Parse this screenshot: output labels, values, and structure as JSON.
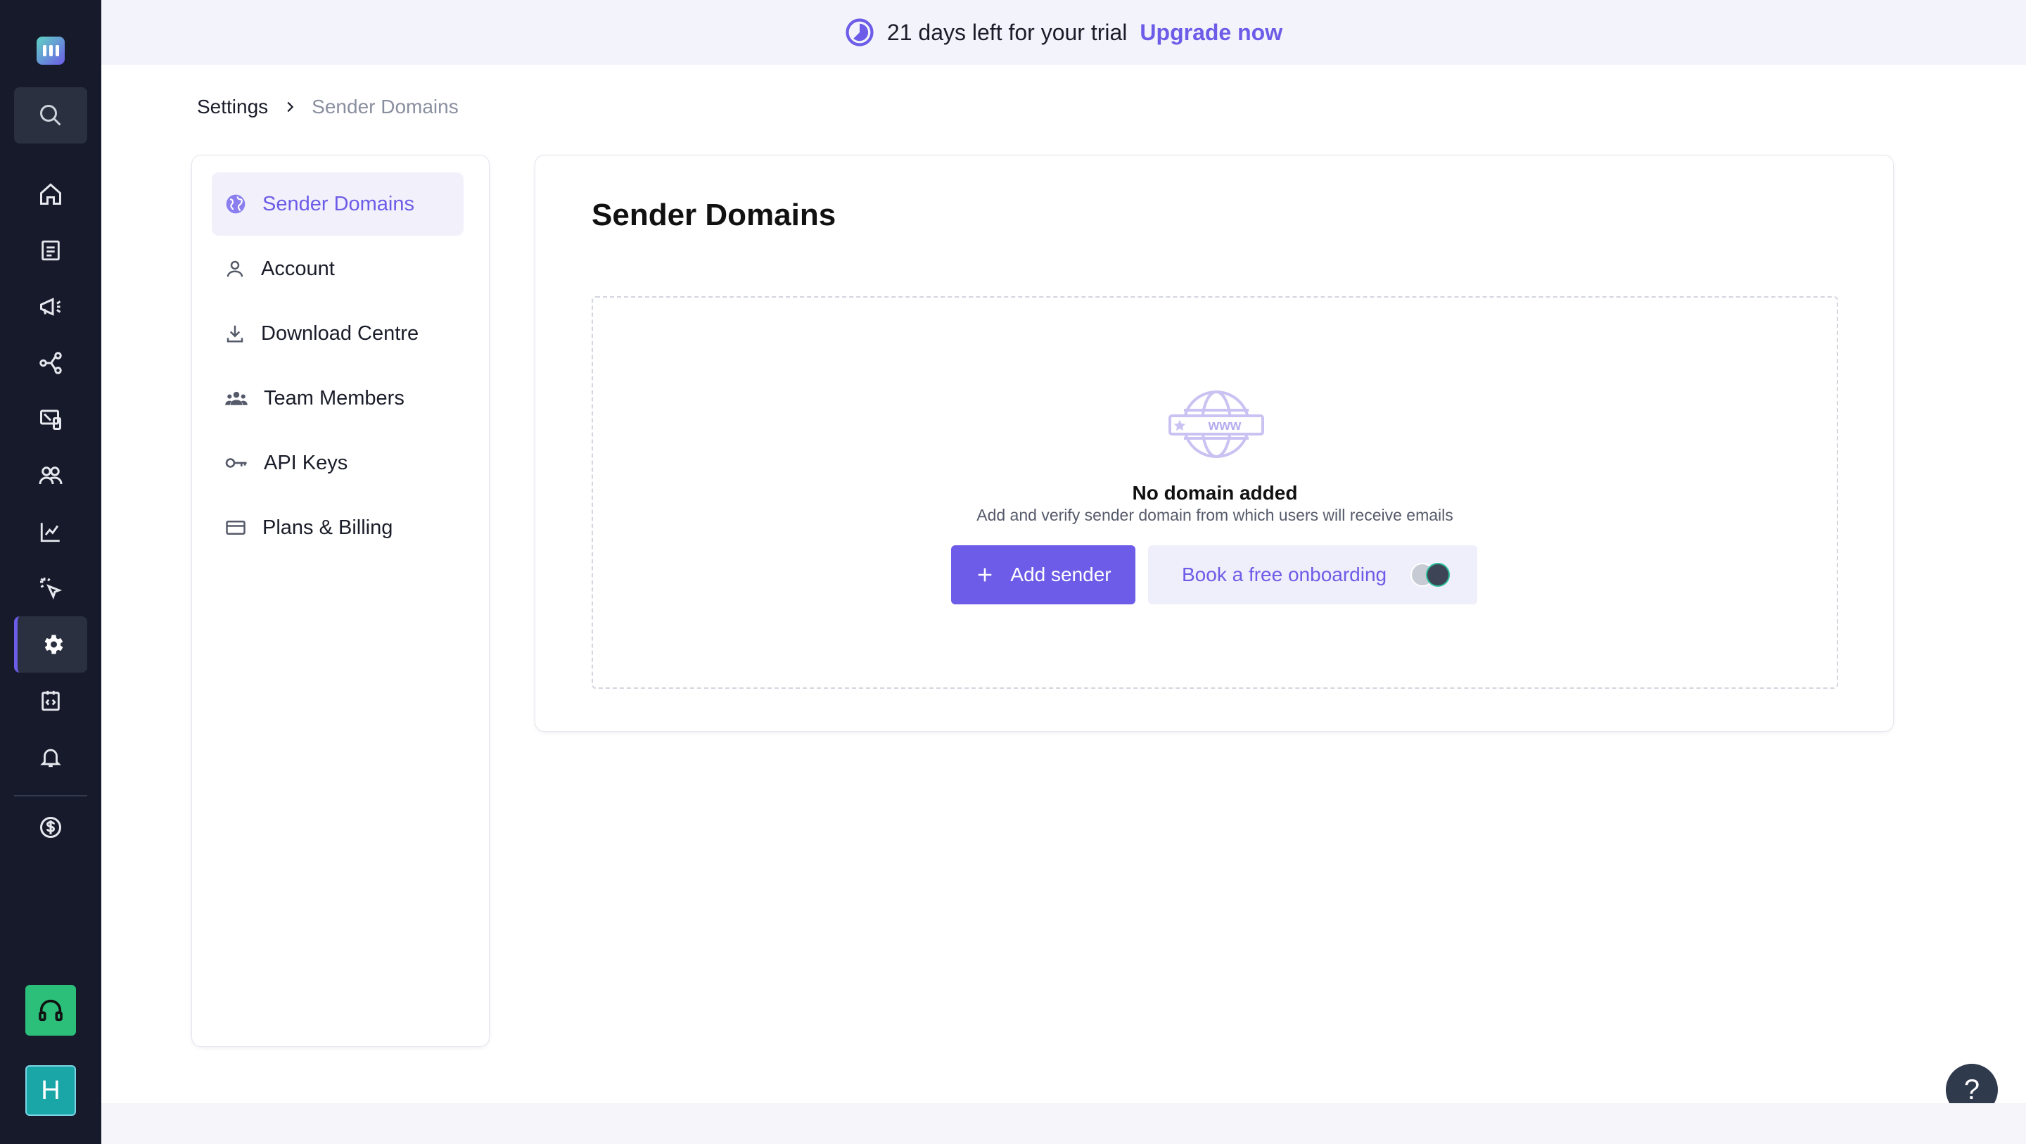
{
  "banner": {
    "trial_text": "21 days left for your trial",
    "upgrade_label": "Upgrade now"
  },
  "breadcrumb": {
    "root": "Settings",
    "separator": ">",
    "current": "Sender Domains"
  },
  "rail": {
    "avatar_initial": "H",
    "nav_icons": [
      "home-icon",
      "templates-icon",
      "campaigns-icon",
      "journeys-icon",
      "inapp-icon",
      "users-icon",
      "analytics-icon",
      "events-icon",
      "settings-icon",
      "developer-icon",
      "notifications-icon",
      "billing-icon"
    ],
    "active": "settings-icon"
  },
  "menu": {
    "items": [
      {
        "label": "Sender Domains",
        "icon": "globe-icon",
        "active": true
      },
      {
        "label": "Account",
        "icon": "user-icon",
        "active": false
      },
      {
        "label": "Download Centre",
        "icon": "download-icon",
        "active": false
      },
      {
        "label": "Team Members",
        "icon": "team-icon",
        "active": false
      },
      {
        "label": "API Keys",
        "icon": "key-icon",
        "active": false
      },
      {
        "label": "Plans & Billing",
        "icon": "card-icon",
        "active": false
      }
    ]
  },
  "main": {
    "title": "Sender Domains",
    "empty_heading": "No domain added",
    "empty_sub": "Add and verify sender domain from which users will receive emails",
    "empty_illustration_text": "www",
    "add_label": "Add sender",
    "book_label": "Book a free onboarding"
  },
  "help": {
    "label": "?"
  },
  "colors": {
    "accent": "#6c5ce7",
    "rail_bg": "#161a2b",
    "support_green": "#2bbf7a",
    "avatar_teal": "#1aa6a6"
  }
}
